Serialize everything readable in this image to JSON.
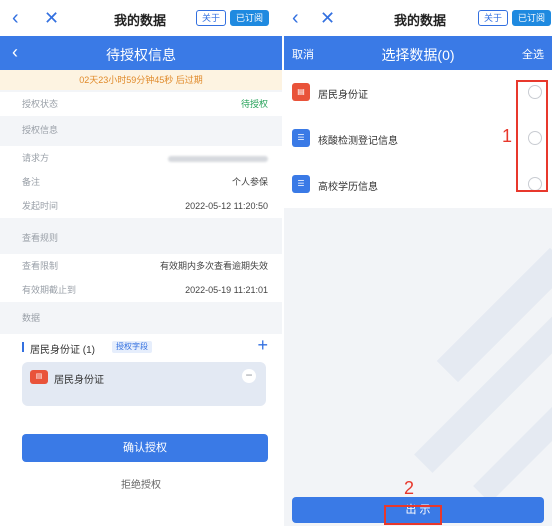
{
  "left": {
    "topbar": {
      "title": "我的数据",
      "about_label": "关于",
      "subscribed_label": "已订阅"
    },
    "page_title": "待授权信息",
    "countdown": "02天23小时59分钟45秒 后过期",
    "auth_status": {
      "label": "授权状态",
      "value": "待授权"
    },
    "section_auth_info": "授权信息",
    "requester": {
      "label": "请求方"
    },
    "remark": {
      "label": "备注",
      "value": "个人参保"
    },
    "initiated_time": {
      "label": "发起时间",
      "value": "2022-05-12 11:20:50"
    },
    "section_view_rules": "查看规则",
    "view_limit": {
      "label": "查看限制",
      "value": "有效期内多次查看逾期失效"
    },
    "valid_until": {
      "label": "有效期截止到",
      "value": "2022-05-19 11:21:01"
    },
    "section_data": "数据",
    "data_group": {
      "label": "居民身份证 (1)",
      "tag": "授权字段"
    },
    "data_card_label": "居民身份证",
    "confirm_button": "确认授权",
    "reject_button": "拒绝授权"
  },
  "right": {
    "topbar": {
      "title": "我的数据",
      "about_label": "关于",
      "subscribed_label": "已订阅"
    },
    "cancel_label": "取消",
    "page_title": "选择数据(0)",
    "select_all_label": "全选",
    "items": [
      {
        "name": "居民身份证",
        "icon": "id-card-icon"
      },
      {
        "name": "核酸检测登记信息",
        "icon": "document-icon"
      },
      {
        "name": "高校学历信息",
        "icon": "document-icon"
      }
    ],
    "export_button": "出 示"
  },
  "annotations": {
    "marker_1": "1",
    "marker_2": "2"
  },
  "colors": {
    "accent": "#3a7ae6",
    "warning_bg": "#fdf3e1",
    "warning_text": "#e08a2a",
    "status_green": "#27a35a",
    "annotation_red": "#e8382c"
  }
}
